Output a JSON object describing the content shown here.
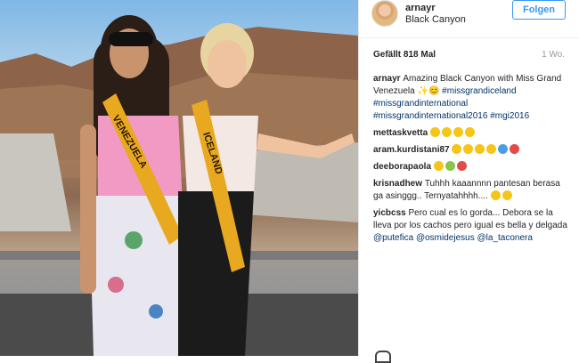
{
  "post": {
    "username": "arnayr",
    "location": "Black Canyon",
    "follow_label": "Folgen",
    "likes": "Gefällt 818 Mal",
    "time": "1 Wo."
  },
  "photo": {
    "sash_left": "VENEZUELA",
    "sash_right": "ICELAND"
  },
  "comments": [
    {
      "user": "arnayr",
      "parts": [
        {
          "type": "text",
          "value": "Amazing Black Canyon with Miss Grand Venezuela ✨😊 "
        },
        {
          "type": "tag",
          "value": "#missgrandiceland"
        },
        {
          "type": "text",
          "value": " "
        },
        {
          "type": "tag",
          "value": "#missgrandinternational"
        },
        {
          "type": "text",
          "value": " "
        },
        {
          "type": "tag",
          "value": "#missgrandinternational2016"
        },
        {
          "type": "text",
          "value": " "
        },
        {
          "type": "tag",
          "value": "#mgi2016"
        }
      ]
    },
    {
      "user": "mettaskvetta",
      "emojis": [
        "yel",
        "yel",
        "yel",
        "yel"
      ]
    },
    {
      "user": "aram.kurdistani87",
      "emojis": [
        "yel",
        "yel",
        "yel",
        "yel",
        "blu",
        "red"
      ]
    },
    {
      "user": "deeborapaola",
      "emojis": [
        "yel",
        "grn",
        "red"
      ]
    },
    {
      "user": "krisnadhew",
      "text": "Tuhhh kaaannnn pantesan berasa ga asinggg.. Ternyatahhhh....",
      "emojis": [
        "yel",
        "yel"
      ]
    },
    {
      "user": "yicbcss",
      "parts": [
        {
          "type": "text",
          "value": "Pero cual es lo gorda... Debora se la lleva por los cachos pero igual es bella y delgada "
        },
        {
          "type": "tag",
          "value": "@putefica"
        },
        {
          "type": "text",
          "value": " "
        },
        {
          "type": "tag",
          "value": "@osmidejesus"
        },
        {
          "type": "text",
          "value": " "
        },
        {
          "type": "tag",
          "value": "@la_taconera"
        }
      ]
    }
  ],
  "colors": {
    "accent": "#3897f0",
    "link": "#003569",
    "text": "#262626"
  }
}
